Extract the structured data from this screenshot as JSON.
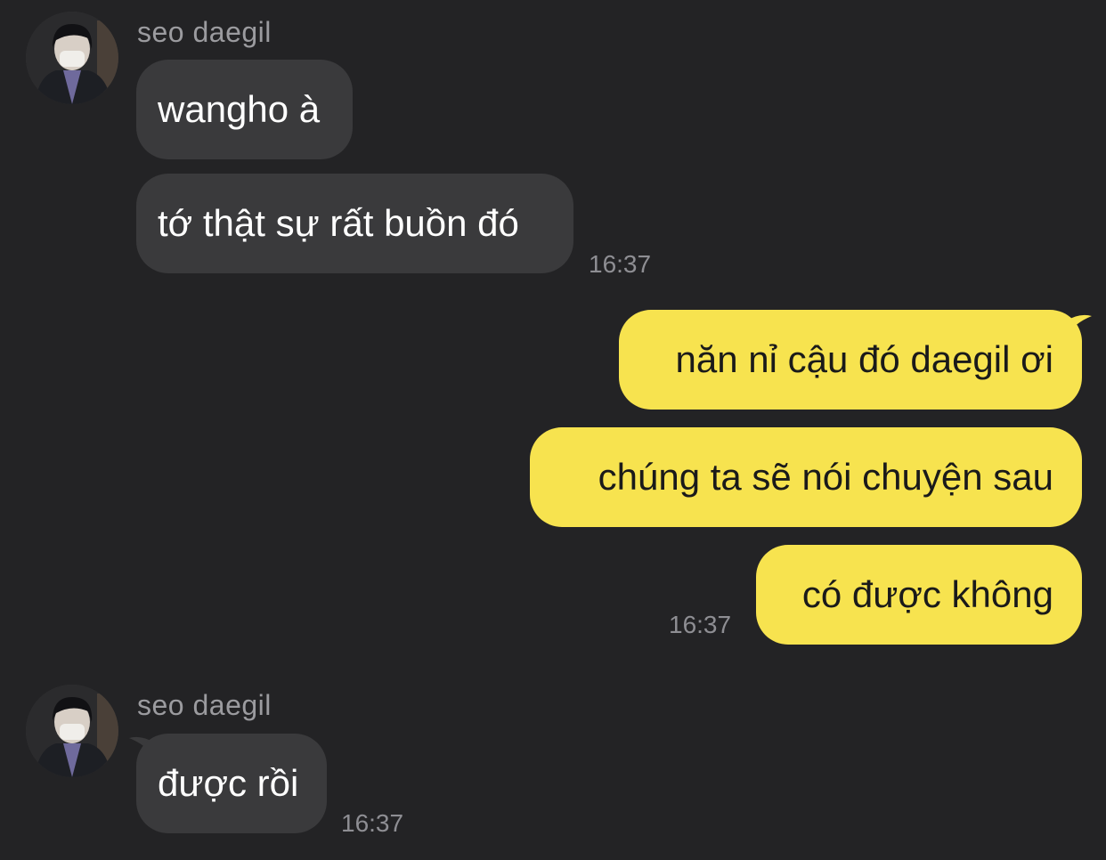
{
  "colors": {
    "background": "#232325",
    "incoming_bubble": "#3a3a3c",
    "outgoing_bubble": "#f7e34f",
    "incoming_text": "#ffffff",
    "outgoing_text": "#1a1a1a",
    "meta_text": "#8e8e93"
  },
  "groups": [
    {
      "sender": "seo daegil",
      "avatar_icon": "profile-photo-avatar",
      "messages": [
        "wangho à",
        "tớ thật sự rất buồn đó"
      ],
      "time": "16:37"
    },
    {
      "sender": "me",
      "messages": [
        "năn nỉ cậu đó daegil ơi",
        "chúng ta sẽ nói chuyện sau",
        "có được không"
      ],
      "time": "16:37"
    },
    {
      "sender": "seo daegil",
      "avatar_icon": "profile-photo-avatar",
      "messages": [
        "được rồi"
      ],
      "time": "16:37"
    }
  ]
}
